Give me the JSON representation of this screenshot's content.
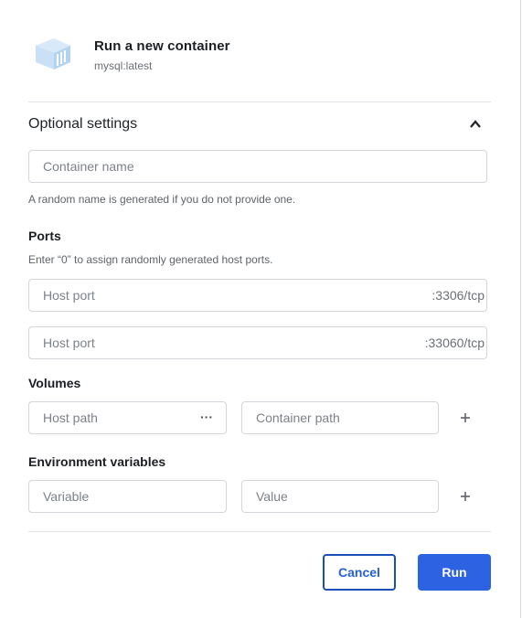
{
  "header": {
    "title": "Run a new container",
    "subtitle": "mysql:latest",
    "icon": "container-icon"
  },
  "optional_settings": {
    "title": "Optional settings",
    "expanded": true,
    "container_name": {
      "placeholder": "Container name",
      "value": "",
      "helper": "A random name is generated if you do not provide one."
    }
  },
  "ports": {
    "label": "Ports",
    "helper": "Enter “0” to assign randomly generated host ports.",
    "rows": [
      {
        "placeholder": "Host port",
        "value": "",
        "suffix": ":3306/tcp"
      },
      {
        "placeholder": "Host port",
        "value": "",
        "suffix": ":33060/tcp"
      }
    ]
  },
  "volumes": {
    "label": "Volumes",
    "host_path_placeholder": "Host path",
    "container_path_placeholder": "Container path",
    "browse_label": "···"
  },
  "env": {
    "label": "Environment variables",
    "variable_placeholder": "Variable",
    "value_placeholder": "Value"
  },
  "actions": {
    "cancel_label": "Cancel",
    "run_label": "Run"
  },
  "colors": {
    "accent": "#2d62e3",
    "cancel_border": "#1b4fb8",
    "icon": "#bcd8f5"
  }
}
